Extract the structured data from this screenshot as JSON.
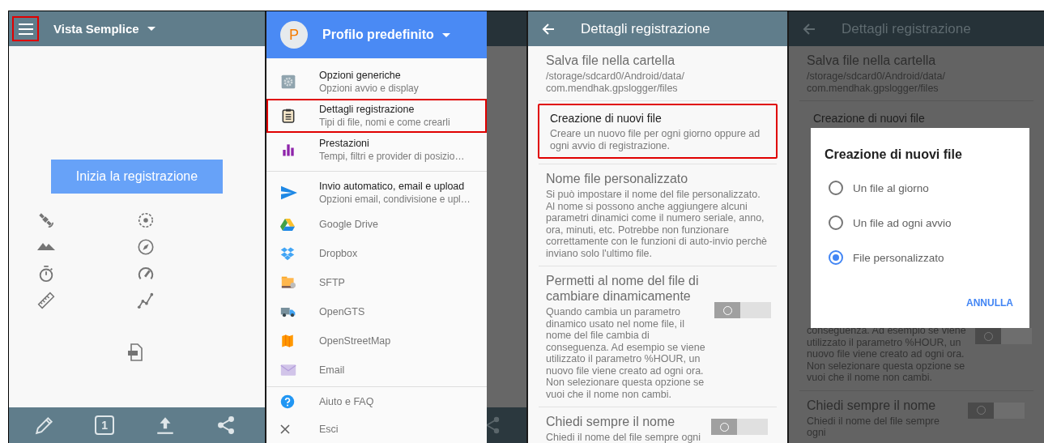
{
  "simple_view": {
    "title": "Vista Semplice",
    "menu_highlighted": true,
    "start_button": "Inizia la registrazione",
    "counter": "1"
  },
  "drawer": {
    "profile_initial": "P",
    "profile_name": "Profilo predefinito",
    "sections": [
      [
        {
          "title": "Opzioni generiche",
          "subtitle": "Opzioni avvio e display",
          "highlighted": false
        },
        {
          "title": "Dettagli registrazione",
          "subtitle": "Tipi di file, nomi e come crearli",
          "highlighted": true
        },
        {
          "title": "Prestazioni",
          "subtitle": "Tempi, filtri e provider di posizio…",
          "highlighted": false
        }
      ],
      [
        {
          "title": "Invio automatico, email e upload",
          "subtitle": "Opzioni email, condivisione e upl…",
          "highlighted": false
        },
        {
          "title": "Google Drive",
          "highlighted": false
        },
        {
          "title": "Dropbox",
          "highlighted": false
        },
        {
          "title": "SFTP",
          "highlighted": false
        },
        {
          "title": "OpenGTS",
          "highlighted": false
        },
        {
          "title": "OpenStreetMap",
          "highlighted": false
        },
        {
          "title": "Email",
          "highlighted": false
        }
      ]
    ],
    "footer_items": [
      {
        "title": "Aiuto e FAQ"
      },
      {
        "title": "Esci"
      }
    ]
  },
  "settings": {
    "title": "Dettagli registrazione",
    "items": [
      {
        "title": "Salva file nella cartella",
        "path_lines": [
          "/storage/sdcard0/Android/data/",
          "com.mendhak.gpslogger/files"
        ],
        "highlighted": false
      },
      {
        "title": "Creazione di nuovi file",
        "summary": "Creare un nuovo file per ogni giorno oppure ad ogni avvio di registrazione.",
        "highlighted": true
      },
      {
        "title": "Nome file personalizzato",
        "summary": "Si può impostare il nome del file personalizzato. Al nome si possono anche aggiungere alcuni parametri dinamici come il numero seriale, anno, ora, minuti, etc. Potrebbe non funzionare correttamente con le funzioni di auto-invio perchè inviano solo l'ultimo file.",
        "highlighted": false
      },
      {
        "title": "Permetti al nome del file di cambiare dinamicamente",
        "summary": "Quando cambia un parametro dinamico usato nel nome file, il nome del file cambia di conseguenza. Ad esempio se viene utilizzato il parametro %HOUR, un nuovo file viene creato ad ogni ora. Non selezionare questa opzione se vuoi che il nome non cambi.",
        "highlighted": false,
        "on": false
      },
      {
        "title": "Chiedi sempre il nome",
        "summary": "Chiedi il nome del file sempre ogni",
        "highlighted": false,
        "on": false
      }
    ]
  },
  "dialog_screen": {
    "title": "Dettagli registrazione",
    "folder_title": "Salva file nella cartella",
    "folder_path_lines": [
      "/storage/sdcard0/Android/data/",
      "com.mendhak.gpslogger/files"
    ],
    "covered_item_title": "Creazione di nuovi file",
    "partial_summary": "conseguenza. Ad esempio se viene utilizzato il parametro %HOUR, un nuovo file viene creato ad ogni ora. Non selezionare questa opzione se vuoi che il nome non cambi.",
    "partial_on": false,
    "last_item": {
      "title": "Chiedi sempre il nome",
      "summary": "Chiedi il nome del file sempre ogni",
      "on": false
    },
    "dialog": {
      "title": "Creazione di nuovi file",
      "options": [
        {
          "label": "Un file al giorno",
          "selected": false
        },
        {
          "label": "Un file ad ogni avvio",
          "selected": false
        },
        {
          "label": "File personalizzato",
          "selected": true
        }
      ],
      "buttons": [
        "ANNULLA"
      ]
    }
  }
}
